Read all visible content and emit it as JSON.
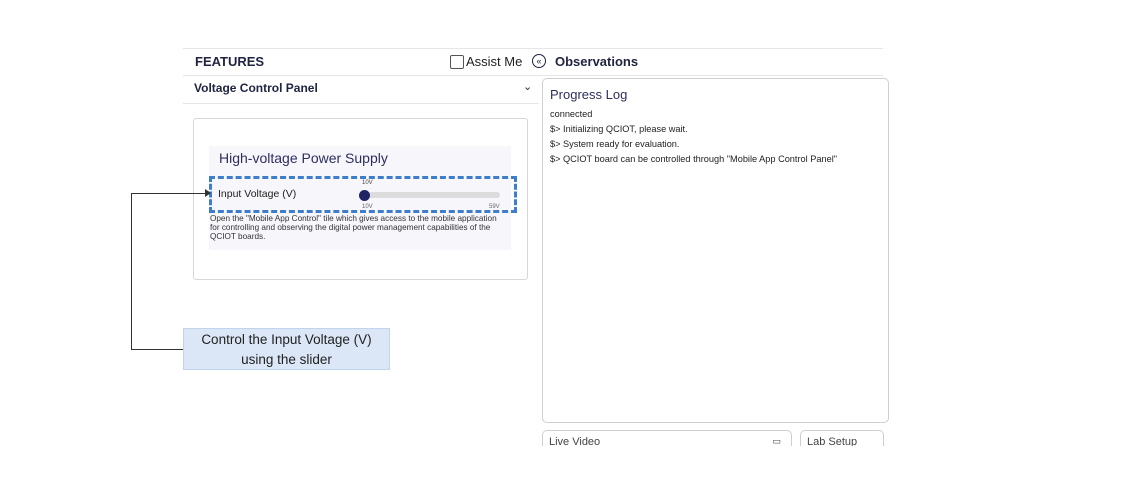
{
  "header": {
    "features_title": "FEATURES",
    "assist_label": "Assist Me",
    "collapse_icon": "«",
    "observations_title": "Observations"
  },
  "left_panel": {
    "title": "Voltage Control Panel",
    "chevron": "⌄",
    "card": {
      "title": "High-voltage Power Supply",
      "slider": {
        "label": "Input Voltage (V)",
        "value": 10,
        "value_label": "10V",
        "min_label": "10V",
        "max_label": "59V"
      },
      "description": "Open the \"Mobile App Control\" tile which gives access to the mobile application for controlling and observing the digital power management capabilities of the QCIOT boards."
    }
  },
  "callout": {
    "line1": "Control the Input Voltage (V)",
    "line2": "using the slider"
  },
  "observations": {
    "log_title": "Progress Log",
    "lines": [
      "connected",
      "$> Initializing QCIOT, please wait.",
      "$> System ready for evaluation.",
      "$> QCIOT board can be controlled through \"Mobile App Control Panel\""
    ]
  },
  "bottom_tabs": {
    "live_video": "Live Video",
    "lab_setup": "Lab Setup"
  }
}
